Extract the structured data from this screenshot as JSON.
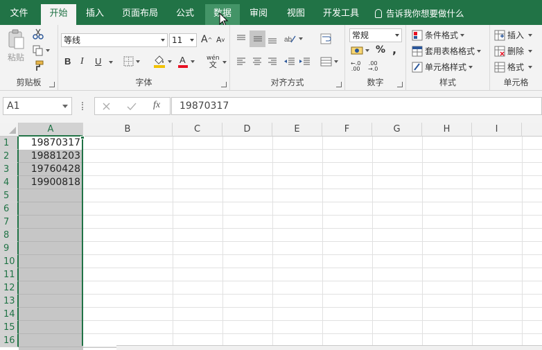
{
  "tabs": [
    "文件",
    "开始",
    "插入",
    "页面布局",
    "公式",
    "数据",
    "审阅",
    "视图",
    "开发工具"
  ],
  "tell_me": "告诉我你想要做什么",
  "clipboard": {
    "paste": "粘贴",
    "label": "剪贴板"
  },
  "font": {
    "name": "等线",
    "size": "11",
    "bold": "B",
    "italic": "I",
    "underline": "U",
    "grow": "A",
    "shrink": "A",
    "phonetic": "wén",
    "label": "字体"
  },
  "alignment": {
    "label": "对齐方式"
  },
  "number": {
    "format": "常规",
    "percent": "%",
    "comma": ",",
    "label": "数字"
  },
  "styles": {
    "conditional": "条件格式",
    "table": "套用表格格式",
    "cell_styles": "单元格样式",
    "label": "样式"
  },
  "cells_group": {
    "insert": "插入",
    "delete": "删除",
    "format": "格式",
    "label": "单元格"
  },
  "namebox": "A1",
  "fx": "fx",
  "formula": "19870317",
  "columns": [
    "A",
    "B",
    "C",
    "D",
    "E",
    "F",
    "G",
    "H",
    "I"
  ],
  "rows": [
    "1",
    "2",
    "3",
    "4",
    "5",
    "6",
    "7",
    "8",
    "9",
    "10",
    "11",
    "12",
    "13",
    "14",
    "15",
    "16"
  ],
  "cells": [
    "19870317",
    "19881203",
    "19760428",
    "19900818"
  ],
  "colors": {
    "accent": "#217346",
    "selection": "#c6c6c6"
  }
}
